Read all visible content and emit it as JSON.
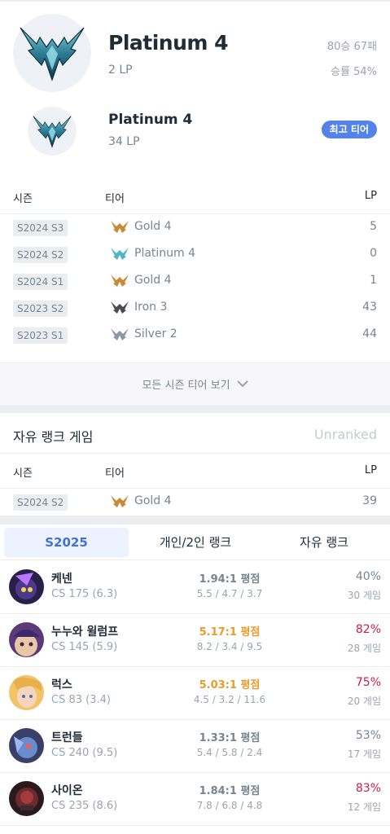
{
  "current_rank": {
    "tier": "Platinum 4",
    "lp": "2 LP",
    "win_loss": "80승 67패",
    "win_rate": "승률 54%"
  },
  "peak_rank": {
    "tier": "Platinum 4",
    "lp": "34 LP",
    "badge": "최고 티어"
  },
  "season_table": {
    "headers": {
      "season": "시즌",
      "tier": "티어",
      "lp": "LP"
    },
    "rows": [
      {
        "season": "S2024 S3",
        "tier": "Gold 4",
        "lp": "5"
      },
      {
        "season": "S2024 S2",
        "tier": "Platinum 4",
        "lp": "0"
      },
      {
        "season": "S2024 S1",
        "tier": "Gold 4",
        "lp": "1"
      },
      {
        "season": "S2023 S2",
        "tier": "Iron 3",
        "lp": "43"
      },
      {
        "season": "S2023 S1",
        "tier": "Silver 2",
        "lp": "44"
      }
    ],
    "view_all": "모든 시즌 티어 보기"
  },
  "flex_rank": {
    "title": "자유 랭크 게임",
    "status": "Unranked",
    "headers": {
      "season": "시즌",
      "tier": "티어",
      "lp": "LP"
    },
    "rows": [
      {
        "season": "S2024 S2",
        "tier": "Gold 4",
        "lp": "39"
      }
    ]
  },
  "tabs": [
    {
      "label": "S2025",
      "active": true
    },
    {
      "label": "개인/2인 랭크",
      "active": false
    },
    {
      "label": "자유 랭크",
      "active": false
    }
  ],
  "champions": [
    {
      "name": "케넨",
      "cs": "CS 175 (6.3)",
      "kda": "1.94:1 평점",
      "kda_detail": "5.5 / 4.7 / 3.7",
      "win_rate": "40%",
      "games": "30 게임"
    },
    {
      "name": "누누와 윌럼프",
      "cs": "CS 145 (5.9)",
      "kda": "5.17:1 평점",
      "kda_detail": "8.2 / 3.4 / 9.5",
      "win_rate": "82%",
      "games": "28 게임"
    },
    {
      "name": "럭스",
      "cs": "CS 83 (3.4)",
      "kda": "5.03:1 평점",
      "kda_detail": "4.5 / 3.2 / 11.6",
      "win_rate": "75%",
      "games": "20 게임"
    },
    {
      "name": "트런들",
      "cs": "CS 240 (9.5)",
      "kda": "1.33:1 평점",
      "kda_detail": "5.4 / 5.8 / 2.4",
      "win_rate": "53%",
      "games": "17 게임"
    },
    {
      "name": "사이온",
      "cs": "CS 235 (8.6)",
      "kda": "1.84:1 평점",
      "kda_detail": "7.8 / 6.8 / 4.8",
      "win_rate": "83%",
      "games": "12 게임"
    }
  ],
  "colors": {
    "accent": "#5383e8",
    "kda_high": "#e89c2c",
    "win_rate_high": "#d31a45",
    "gold": "#c8893a",
    "platinum": "#4fb4c6",
    "iron": "#4a4a52",
    "silver": "#8a98a5"
  },
  "icons": {
    "tier_emblem": "platinum-emblem-icon",
    "chevron": "chevron-down-icon"
  }
}
